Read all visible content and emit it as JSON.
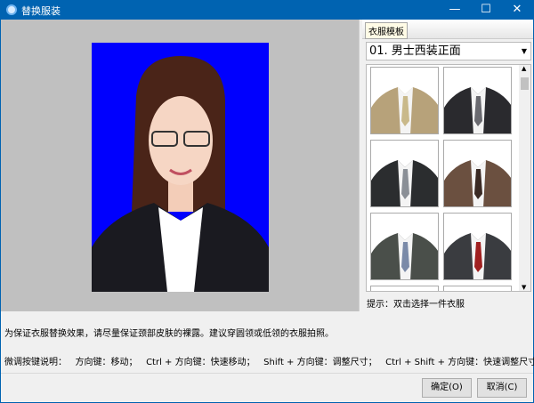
{
  "window": {
    "title": "替换服装",
    "minimize": "—",
    "maximize": "☐",
    "close": "✕"
  },
  "panel": {
    "tab": "衣服模板",
    "selected_category": "01. 男士西装正面",
    "hint": "提示：双击选择一件衣服",
    "thumbnails": [
      {
        "color": "#b7a27a",
        "tie": "#c9b98a"
      },
      {
        "color": "#2a2a2e",
        "tie": "#6a6a70"
      },
      {
        "color": "#2b2d2f",
        "tie": "#8a8f96"
      },
      {
        "color": "#6b5040",
        "tie": "#3a2a24"
      },
      {
        "color": "#4a4f4a",
        "tie": "#7a8aa8"
      },
      {
        "color": "#3a3c40",
        "tie": "#a02020"
      }
    ]
  },
  "instructions": {
    "line1": "为保证衣服替换效果，请尽量保证颈部皮肤的裸露。建议穿圆领或低领的衣服拍照。",
    "line2": "微调按键说明：   方向键：移动；   Ctrl + 方向键：快速移动；   Shift + 方向键：调整尺寸；   Ctrl + Shift + 方向键：快速调整尺寸。"
  },
  "buttons": {
    "ok": "确定(O)",
    "cancel": "取消(C)"
  },
  "colors": {
    "titlebar": "#0063b1",
    "photo_background": "#0000fe"
  }
}
